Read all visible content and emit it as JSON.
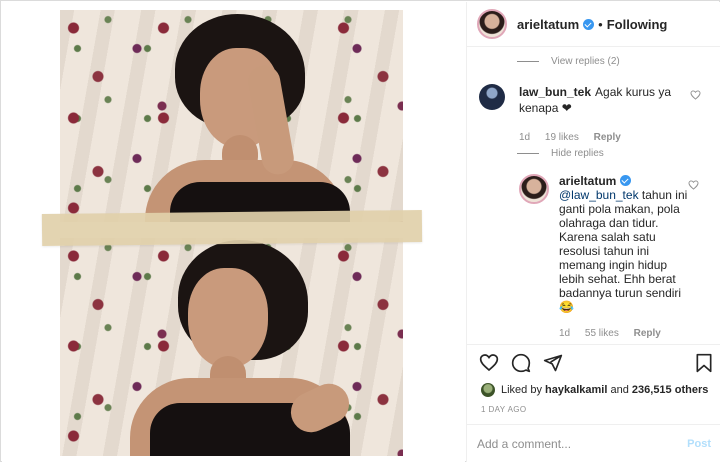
{
  "header": {
    "username": "arieltatum",
    "separator": "•",
    "follow_state": "Following"
  },
  "thread": {
    "view_replies": "View replies (2)",
    "hide_replies": "Hide replies"
  },
  "comment": {
    "username": "law_bun_tek",
    "text": "Agak kurus ya kenapa ❤",
    "age": "1d",
    "likes": "19 likes",
    "reply_label": "Reply"
  },
  "reply": {
    "username": "arieltatum",
    "mention": "@law_bun_tek",
    "text": " tahun ini ganti pola makan, pola olahraga dan tidur. Karena salah satu resolusi tahun ini memang ingin hidup lebih sehat. Ehh berat badannya turun sendiri 😂",
    "age": "1d",
    "likes": "55 likes",
    "reply_label": "Reply"
  },
  "likes_line": {
    "prefix": "Liked by ",
    "liker": "haykalkamil",
    "middle": " and ",
    "count": "236,515 others"
  },
  "date": "1 DAY AGO",
  "composer": {
    "placeholder": "Add a comment...",
    "post_label": "Post"
  },
  "icons": {
    "like": "heart-icon",
    "comment": "comment-icon",
    "share": "share-icon",
    "save": "bookmark-icon",
    "verified": "verified-badge-icon"
  },
  "colors": {
    "link": "#00376b",
    "verified": "#3897f0",
    "muted": "#8e8e8e",
    "post_disabled": "#b2dffc"
  }
}
